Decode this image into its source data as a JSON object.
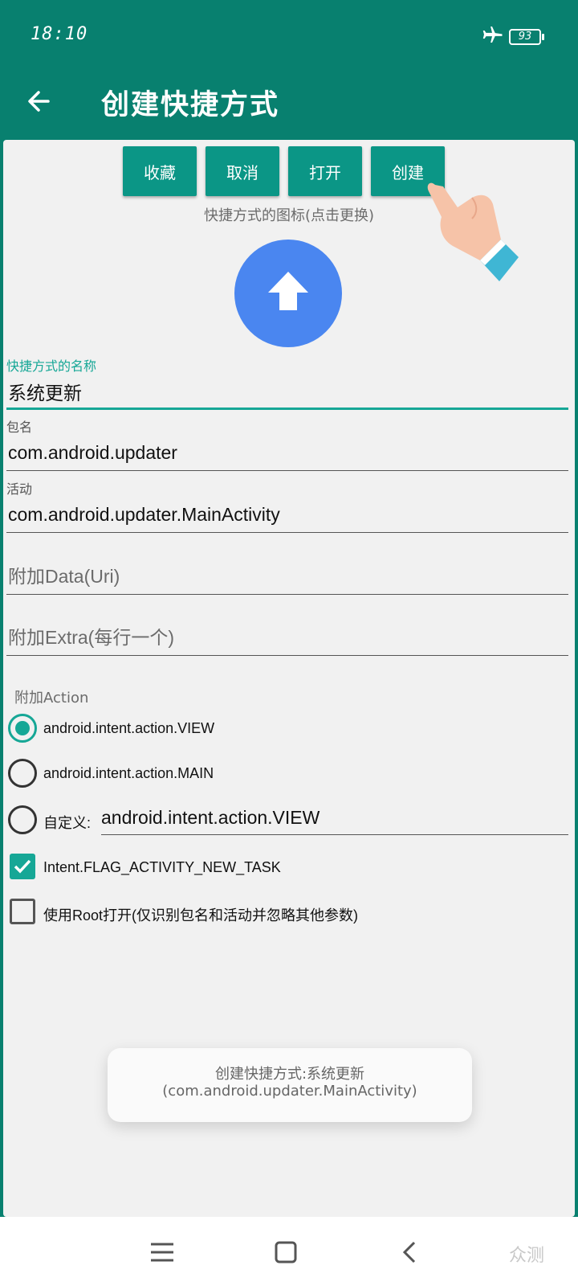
{
  "status_bar": {
    "time": "18:10",
    "battery": "93"
  },
  "app_bar": {
    "title": "创建快捷方式"
  },
  "actions": {
    "favorite": "收藏",
    "cancel": "取消",
    "open": "打开",
    "create": "创建"
  },
  "shortcut_icon": {
    "hint": "快捷方式的图标(点击更换)",
    "icon": "arrow-up-icon",
    "color": "#4a86f0"
  },
  "fields": {
    "name_label": "快捷方式的名称",
    "name_value": "系统更新",
    "package_label": "包名",
    "package_value": "com.android.updater",
    "activity_label": "活动",
    "activity_value": "com.android.updater.MainActivity",
    "data_placeholder": "附加Data(Uri)",
    "extra_placeholder": "附加Extra(每行一个)"
  },
  "action_section": {
    "label": "附加Action",
    "options": [
      {
        "label": "android.intent.action.VIEW",
        "checked": true
      },
      {
        "label": "android.intent.action.MAIN",
        "checked": false
      },
      {
        "label": "自定义:",
        "checked": false
      }
    ],
    "custom_value": "android.intent.action.VIEW"
  },
  "checkboxes": [
    {
      "label": "Intent.FLAG_ACTIVITY_NEW_TASK",
      "checked": true
    },
    {
      "label": "使用Root打开(仅识别包名和活动并忽略其他参数)",
      "checked": false
    }
  ],
  "toast": {
    "line1": "创建快捷方式:系统更新",
    "line2": "(com.android.updater.MainActivity)"
  },
  "watermark": "众测",
  "colors": {
    "primary": "#08806f",
    "accent": "#16a796",
    "button": "#0b9686"
  }
}
